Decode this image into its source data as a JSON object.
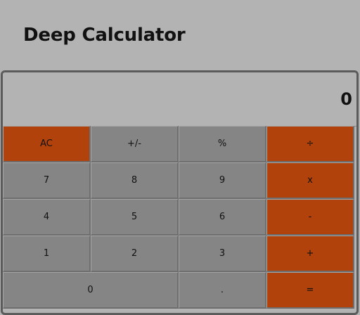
{
  "header": {
    "title": "Deep Calculator"
  },
  "display": {
    "value": "0"
  },
  "keys": {
    "ac": "AC",
    "sign": "+/-",
    "percent": "%",
    "divide": "÷",
    "seven": "7",
    "eight": "8",
    "nine": "9",
    "multiply": "x",
    "four": "4",
    "five": "5",
    "six": "6",
    "subtract": "-",
    "one": "1",
    "two": "2",
    "three": "3",
    "add": "+",
    "zero": "0",
    "decimal": ".",
    "equals": "="
  },
  "colors": {
    "operator": "#b1420c",
    "key": "#858585",
    "background": "#b3b3b3"
  }
}
